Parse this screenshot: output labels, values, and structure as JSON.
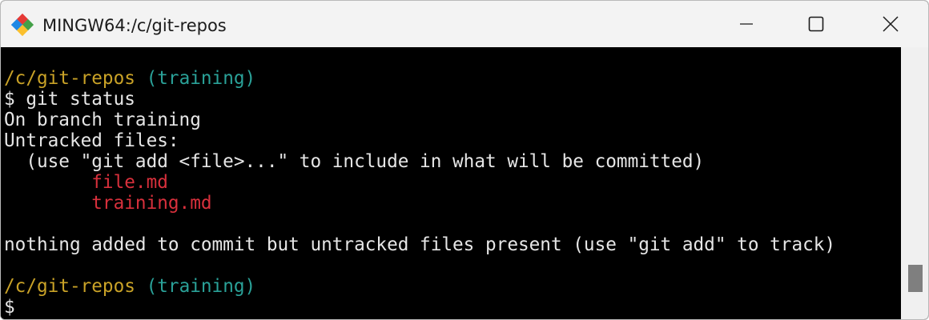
{
  "window": {
    "title": "MINGW64:/c/git-repos",
    "icon": "git-for-windows-icon"
  },
  "controls": {
    "minimize_icon": "minimize-icon",
    "maximize_icon": "maximize-icon",
    "close_icon": "close-icon"
  },
  "terminal": {
    "lines": [
      {
        "type": "prompt",
        "path": "/c/git-repos",
        "branch": "(training)"
      },
      {
        "type": "output",
        "text": "$ git status"
      },
      {
        "type": "output",
        "text": "On branch training"
      },
      {
        "type": "output",
        "text": "Untracked files:"
      },
      {
        "type": "output",
        "text": "  (use \"git add <file>...\" to include in what will be committed)"
      },
      {
        "type": "untracked",
        "text": "        file.md"
      },
      {
        "type": "untracked",
        "text": "        training.md"
      },
      {
        "type": "blank",
        "text": ""
      },
      {
        "type": "output",
        "text": "nothing added to commit but untracked files present (use \"git add\" to track)"
      },
      {
        "type": "blank",
        "text": ""
      },
      {
        "type": "prompt",
        "path": "/c/git-repos",
        "branch": "(training)"
      },
      {
        "type": "output",
        "text": "$"
      }
    ]
  },
  "colors": {
    "background": "#000000",
    "text": "#e6e6e6",
    "path": "#c9a227",
    "branch": "#2aa198",
    "untracked": "#d8303c"
  }
}
